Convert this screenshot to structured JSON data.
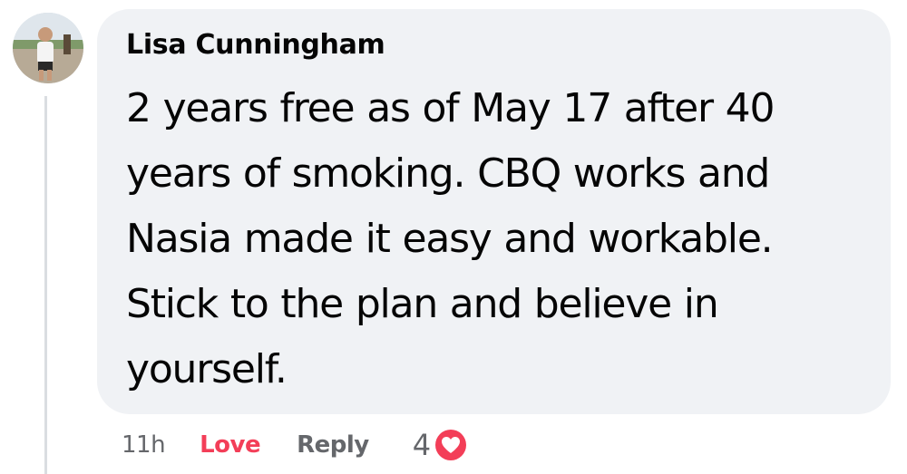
{
  "comment": {
    "author": "Lisa Cunningham",
    "text": "2 years free as of May 17 after 40 years of smoking. CBQ works and Nasia made it easy and workable. Stick to the plan and believe in yourself.",
    "avatar_icon": "profile-photo"
  },
  "actions": {
    "time": "11h",
    "love_label": "Love",
    "reply_label": "Reply",
    "reaction_count": "4",
    "reaction_icon": "heart-icon"
  },
  "colors": {
    "bubble_bg": "#f0f2f5",
    "love_red": "#f33e58",
    "muted_gray": "#65676b",
    "text_dark": "#050505"
  }
}
